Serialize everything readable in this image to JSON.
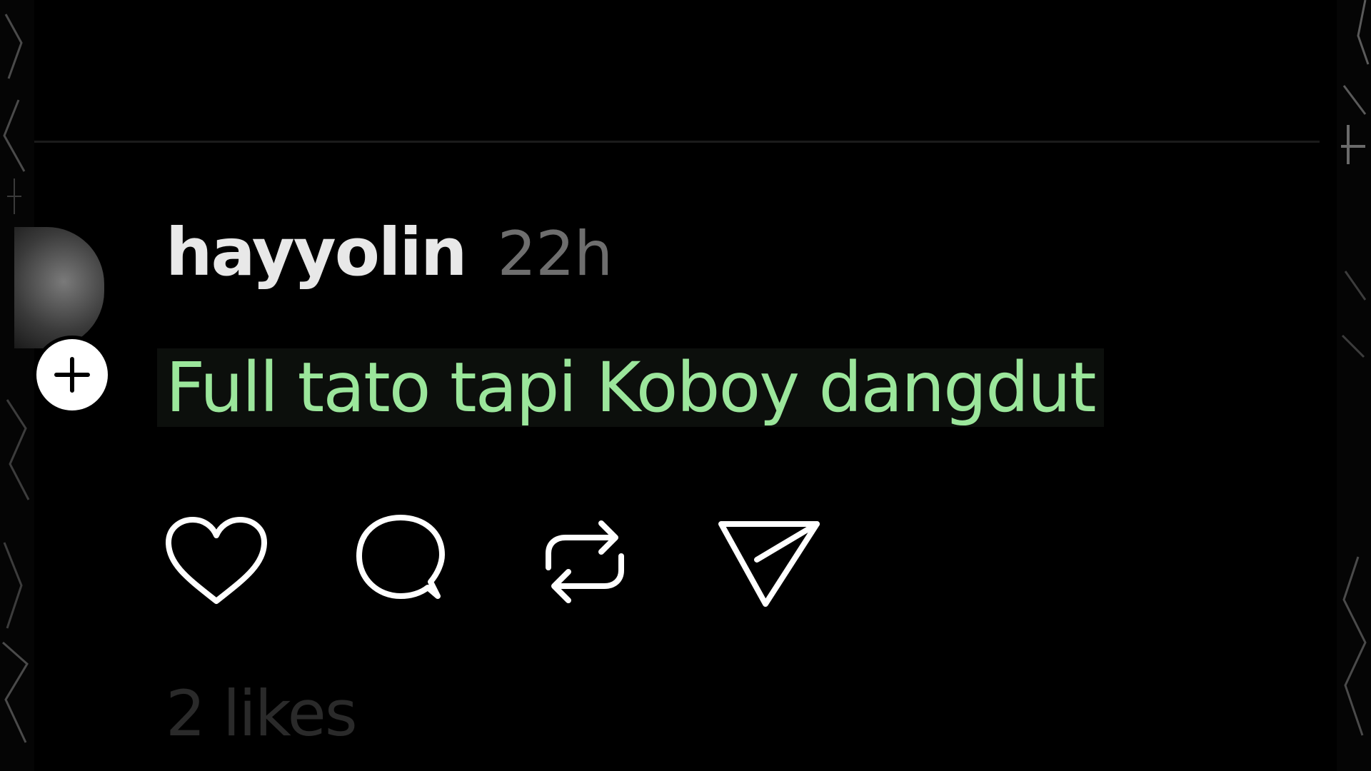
{
  "post": {
    "username": "hayyolin",
    "time": "22h",
    "caption": "Full tato tapi Koboy dangdut",
    "likes": "2 likes"
  },
  "actions": {
    "like_icon": "heart-icon",
    "comment_icon": "comment-icon",
    "repost_icon": "repost-icon",
    "share_icon": "send-icon"
  },
  "colors": {
    "background": "#000000",
    "username": "#e8e8e8",
    "time": "#6e6e6e",
    "caption": "#9be69b",
    "likes": "#2a2a2a"
  }
}
